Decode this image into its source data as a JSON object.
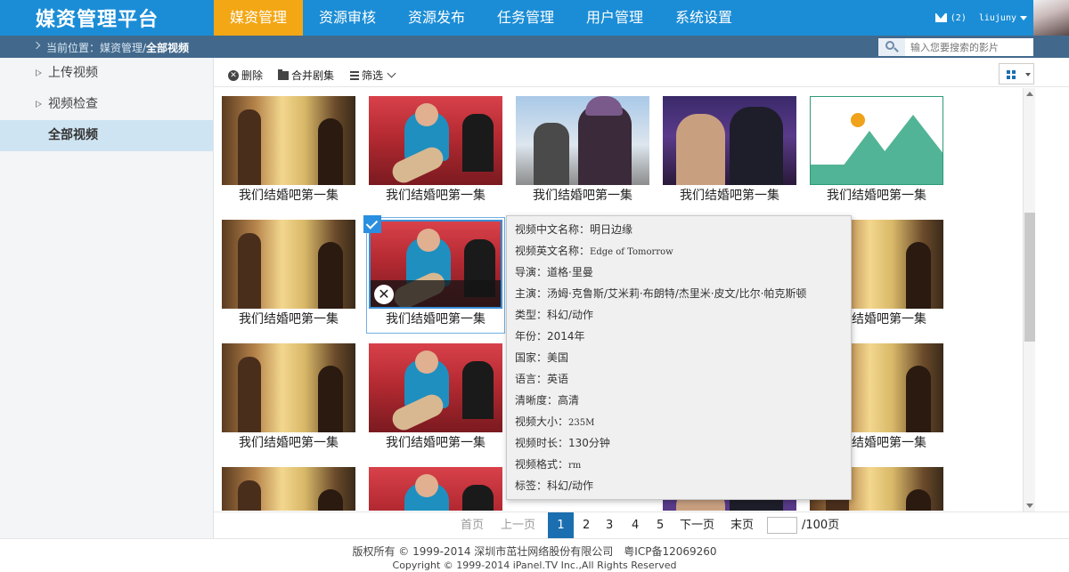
{
  "header": {
    "logo": "媒资管理平台",
    "nav": [
      "媒资管理",
      "资源审核",
      "资源发布",
      "任务管理",
      "用户管理",
      "系统设置"
    ],
    "active_nav": "媒资管理",
    "message_count": "(2)",
    "username": "liujuny"
  },
  "breadcrumb": {
    "prefix": "当前位置：媒资管理/",
    "current": "全部视频"
  },
  "search": {
    "placeholder": "输入您要搜索的影片"
  },
  "sidebar": {
    "items": [
      {
        "label": "上传视频"
      },
      {
        "label": "视频检查"
      },
      {
        "label": "全部视频"
      }
    ],
    "active": "全部视频"
  },
  "toolbar": {
    "delete_label": "删除",
    "merge_label": "合并剧集",
    "filter_label": "筛选"
  },
  "video_title": "我们结婚吧第一集",
  "tooltip": {
    "lines": [
      {
        "label": "视频中文名称：",
        "value": "明日边缘"
      },
      {
        "label": "视频英文名称：",
        "value": "Edge of Tomorrow"
      },
      {
        "label": "导演：",
        "value": "道格·里曼"
      },
      {
        "label": "主演：",
        "value": "汤姆·克鲁斯/艾米莉·布朗特/杰里米·皮文/比尔·帕克斯顿"
      },
      {
        "label": "类型：",
        "value": "科幻/动作"
      },
      {
        "label": "年份：",
        "value": "2014年"
      },
      {
        "label": "国家：",
        "value": "美国"
      },
      {
        "label": "语言：",
        "value": "英语"
      },
      {
        "label": "清晰度：",
        "value": "高清"
      },
      {
        "label": "视频大小：",
        "value": "235M"
      },
      {
        "label": "视频时长：",
        "value": "130分钟"
      },
      {
        "label": "视频格式：",
        "value": "rm"
      },
      {
        "label": "标签：",
        "value": "科幻/动作"
      }
    ]
  },
  "pagination": {
    "first": "首页",
    "prev": "上一页",
    "pages": [
      "1",
      "2",
      "3",
      "4",
      "5"
    ],
    "current": "1",
    "next": "下一页",
    "last": "末页",
    "total": "/100页"
  },
  "footer": {
    "line1": "版权所有 © 1999-2014 深圳市茁壮网络股份有限公司　粤ICP备12069260",
    "line2": "Copyright © 1999-2014 iPanel.TV Inc.,All Rights Reserved"
  },
  "colors": {
    "header_bg": "#1b8dd6",
    "nav_active": "#f3a715",
    "crumb_bg": "#42698c",
    "page_current": "#1b6fb0"
  }
}
